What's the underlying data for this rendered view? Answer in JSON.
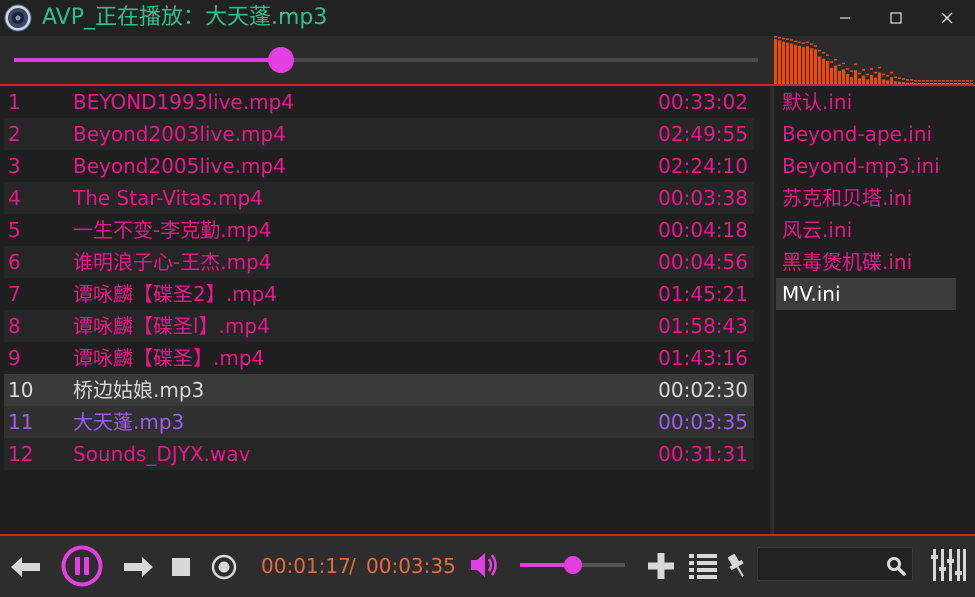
{
  "colors": {
    "title": "#2ec08a",
    "track_pink": "#e8168e",
    "playing_purple": "#a05bf0",
    "selected_text": "#d8d8d8",
    "time_orange": "#e86a3a",
    "accent_magenta": "#e040e0",
    "spectrum_orange": "#f04a00",
    "preset_pink": "#e8168e",
    "preset_selected": "#ffffff"
  },
  "window": {
    "title": "AVP_正在播放：大天蓬.mp3",
    "icons": {
      "app": "speaker-app-icon",
      "minimize": "minimize-icon",
      "maximize": "maximize-icon",
      "close": "close-icon"
    }
  },
  "seek": {
    "progress": 0.359
  },
  "spectrum": {
    "levels": [
      0.98,
      0.95,
      0.92,
      0.9,
      0.88,
      0.85,
      0.83,
      0.8,
      0.82,
      0.78,
      0.75,
      0.6,
      0.55,
      0.5,
      0.35,
      0.4,
      0.28,
      0.32,
      0.22,
      0.15,
      0.3,
      0.12,
      0.18,
      0.1,
      0.2,
      0.14,
      0.25,
      0.1,
      0.08,
      0.15,
      0.06,
      0.05,
      0.04,
      0.03,
      0.03,
      0.02,
      0.02,
      0.02,
      0.02,
      0.02,
      0.02,
      0.02,
      0.02,
      0.02,
      0.02,
      0.02,
      0.02,
      0.02,
      0.02,
      0.02
    ],
    "peaks": [
      1.0,
      0.98,
      0.96,
      0.95,
      0.93,
      0.9,
      0.88,
      0.86,
      0.88,
      0.84,
      0.8,
      0.7,
      0.65,
      0.6,
      0.45,
      0.5,
      0.38,
      0.42,
      0.3,
      0.25,
      0.4,
      0.2,
      0.28,
      0.18,
      0.3,
      0.22,
      0.33,
      0.18,
      0.15,
      0.22,
      0.12,
      0.1,
      0.08,
      0.06,
      0.06,
      0.04,
      0.04,
      0.04,
      0.04,
      0.04,
      0.04,
      0.04,
      0.04,
      0.04,
      0.04,
      0.04,
      0.04,
      0.04,
      0.04,
      0.04
    ]
  },
  "playlist": {
    "tracks": [
      {
        "num": "1",
        "name": "BEYOND1993live.mp4",
        "duration": "00:33:02",
        "state": "normal"
      },
      {
        "num": "2",
        "name": "Beyond2003live.mp4",
        "duration": "02:49:55",
        "state": "normal"
      },
      {
        "num": "3",
        "name": "Beyond2005live.mp4",
        "duration": "02:24:10",
        "state": "normal"
      },
      {
        "num": "4",
        "name": "The Star-Vitas.mp4",
        "duration": "00:03:38",
        "state": "normal"
      },
      {
        "num": "5",
        "name": "一生不变-李克勤.mp4",
        "duration": "00:04:18",
        "state": "normal"
      },
      {
        "num": "6",
        "name": "谁明浪子心-王杰.mp4",
        "duration": "00:04:56",
        "state": "normal"
      },
      {
        "num": "7",
        "name": "谭咏麟【碟圣2】.mp4",
        "duration": "01:45:21",
        "state": "normal"
      },
      {
        "num": "8",
        "name": "谭咏麟【碟圣l】.mp4",
        "duration": "01:58:43",
        "state": "normal"
      },
      {
        "num": "9",
        "name": "谭咏麟【碟圣】.mp4",
        "duration": "01:43:16",
        "state": "normal"
      },
      {
        "num": "10",
        "name": "桥边姑娘.mp3",
        "duration": "00:02:30",
        "state": "selected"
      },
      {
        "num": "11",
        "name": "大天蓬.mp3",
        "duration": "00:03:35",
        "state": "playing"
      },
      {
        "num": "12",
        "name": "Sounds_DJYX.wav",
        "duration": "00:31:31",
        "state": "normal"
      }
    ]
  },
  "presets": {
    "items": [
      {
        "label": "默认.ini",
        "selected": false
      },
      {
        "label": "Beyond-ape.ini",
        "selected": false
      },
      {
        "label": "Beyond-mp3.ini",
        "selected": false
      },
      {
        "label": "苏克和贝塔.ini",
        "selected": false
      },
      {
        "label": "风云.ini",
        "selected": false
      },
      {
        "label": "黑毒煲机碟.ini",
        "selected": false
      },
      {
        "label": "MV.ini",
        "selected": true
      }
    ]
  },
  "controls": {
    "elapsed": "00:01:17",
    "separator": "/",
    "total": "00:03:35",
    "volume": 0.5,
    "search": {
      "value": "",
      "placeholder": ""
    },
    "icons": [
      "previous-icon",
      "pause-icon",
      "next-icon",
      "stop-icon",
      "record-icon",
      "volume-icon",
      "add-icon",
      "playlist-icon",
      "pin-icon",
      "search-icon",
      "equalizer-icon"
    ]
  }
}
